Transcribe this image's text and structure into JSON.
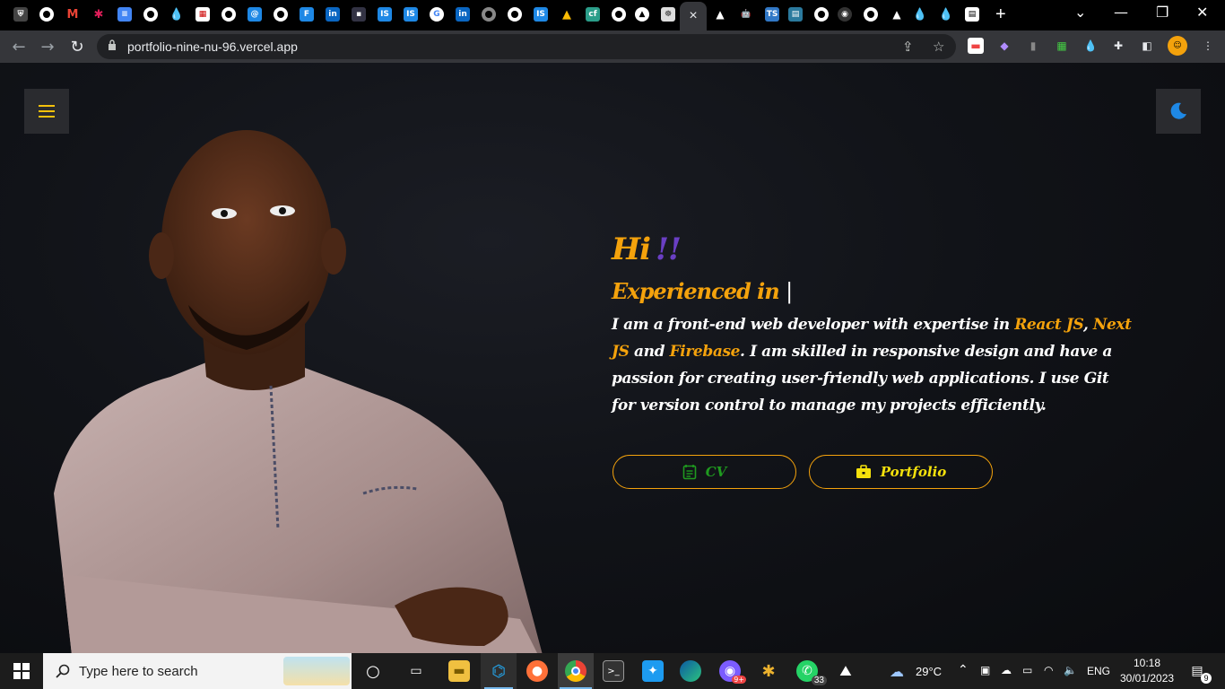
{
  "browser": {
    "url": "portfolio-nine-nu-96.vercel.app",
    "tab_close_glyph": "×",
    "new_tab_glyph": "+",
    "window_controls": [
      "⌄",
      "—",
      "❐",
      "✕"
    ]
  },
  "page": {
    "greeting": "Hi",
    "greeting_suffix": "!!",
    "experience_prefix": "Experienced in",
    "caret": "|",
    "bio": {
      "part1": "I am a front-end web developer with expertise in ",
      "tech1": "React JS",
      "sep1": ", ",
      "tech2": "Next JS",
      "sep2": " and ",
      "tech3": "Firebase",
      "part2": ". I am skilled in responsive design and have a passion for creating user-friendly web applications. I use Git for version control to manage my projects efficiently."
    },
    "cv_button": "CV",
    "portfolio_button": "Portfolio",
    "colors": {
      "accent": "#f4a20c",
      "purple": "#6a3fc4",
      "cv_green": "#1f9a1f",
      "portfolio_yellow": "#f4e10c"
    }
  },
  "taskbar": {
    "search_placeholder": "Type here to search",
    "weather": "29°C",
    "language": "ENG",
    "time": "10:18",
    "date": "30/01/2023",
    "whatsapp_badge": "33",
    "notification_count": "9",
    "cortana_badge": "9+"
  }
}
